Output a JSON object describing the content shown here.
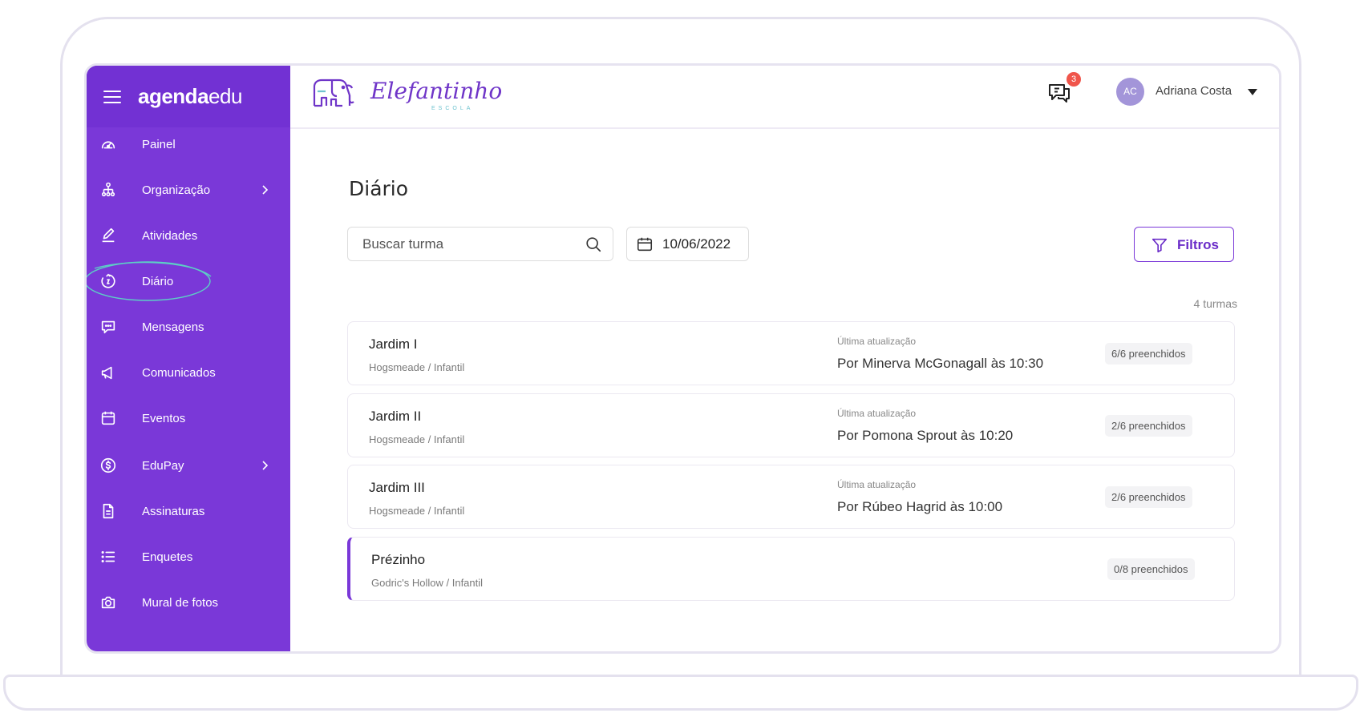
{
  "brand": {
    "bold": "agenda",
    "light": "edu"
  },
  "school": {
    "name": "Elefantinho",
    "subtitle": "ESCOLA"
  },
  "sidebar": {
    "items": [
      {
        "label": "Painel"
      },
      {
        "label": "Organização"
      },
      {
        "label": "Atividades"
      },
      {
        "label": "Diário"
      },
      {
        "label": "Mensagens"
      },
      {
        "label": "Comunicados"
      },
      {
        "label": "Eventos"
      },
      {
        "label": "EduPay"
      },
      {
        "label": "Assinaturas"
      },
      {
        "label": "Enquetes"
      },
      {
        "label": "Mural de fotos"
      }
    ]
  },
  "header": {
    "notification_count": "3",
    "user_initials": "AC",
    "user_name": "Adriana Costa"
  },
  "main": {
    "title": "Diário",
    "search_placeholder": "Buscar turma",
    "date": "10/06/2022",
    "filters_label": "Filtros",
    "count_text": "4 turmas",
    "classes": [
      {
        "name": "Jardim I",
        "sub": "Hogsmeade / Infantil",
        "update_label": "Última atualização",
        "update": "Por Minerva McGonagall às 10:30",
        "badge": "6/6 preenchidos"
      },
      {
        "name": "Jardim II",
        "sub": "Hogsmeade / Infantil",
        "update_label": "Última atualização",
        "update": "Por Pomona Sprout às 10:20",
        "badge": "2/6 preenchidos"
      },
      {
        "name": "Jardim III",
        "sub": "Hogsmeade / Infantil",
        "update_label": "Última atualização",
        "update": "Por Rúbeo Hagrid às 10:00",
        "badge": "2/6 preenchidos"
      },
      {
        "name": "Prézinho",
        "sub": "Godric's Hollow / Infantil",
        "badge": "0/8 preenchidos"
      }
    ]
  },
  "colors": {
    "sidebar": "#7a38d8",
    "accent": "#6a2cc8",
    "badge": "#f0554b",
    "highlight_circle": "#5ccfc5"
  }
}
